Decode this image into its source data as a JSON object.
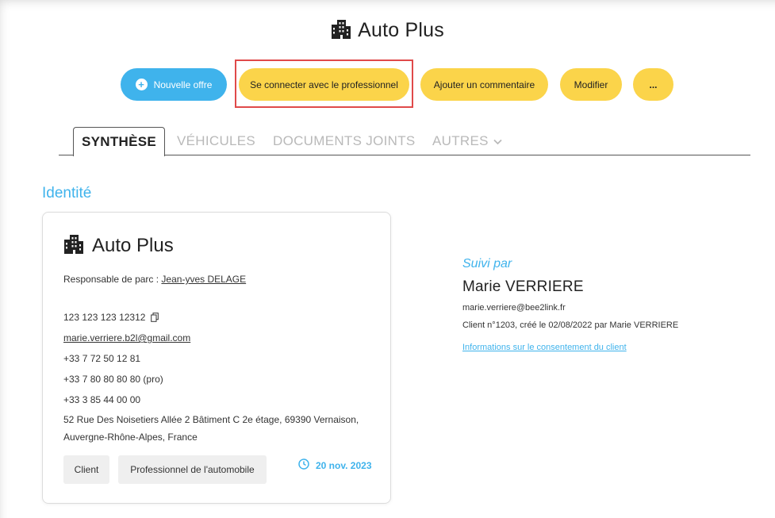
{
  "header": {
    "title": "Auto Plus",
    "icon": "building-icon"
  },
  "actions": {
    "new_offer": "Nouvelle offre",
    "connect_pro": "Se connecter avec le professionnel",
    "add_comment": "Ajouter un commentaire",
    "edit": "Modifier",
    "more": "...",
    "colors": {
      "blue": "#3fb3ec",
      "yellow": "#fbd44a",
      "highlight": "#e04a4a"
    }
  },
  "tabs": [
    {
      "label": "SYNTHÈSE",
      "active": true
    },
    {
      "label": "VÉHICULES",
      "active": false
    },
    {
      "label": "DOCUMENTS JOINTS",
      "active": false
    },
    {
      "label": "AUTRES",
      "active": false,
      "has_dropdown": true
    }
  ],
  "identity": {
    "section_title": "Identité",
    "name": "Auto Plus",
    "manager_label": "Responsable de parc :",
    "manager_name": "Jean-yves DELAGE",
    "siret": "123 123 123 12312",
    "email": "marie.verriere.b2l@gmail.com",
    "phone_1": "+33 7 72 50 12 81",
    "phone_2": "+33 7 80 80 80 80 (pro)",
    "phone_3": "+33 3 85 44 00 00",
    "address_line_1": "52 Rue Des Noisetiers Allée 2 Bâtiment C 2e étage, 69390 Vernaison,",
    "address_line_2": "Auvergne-Rhône-Alpes, France",
    "tags": [
      "Client",
      "Professionnel de l'automobile"
    ],
    "date": "20 nov. 2023"
  },
  "followup": {
    "label": "Suivi par",
    "name": "Marie VERRIERE",
    "email": "marie.verriere@bee2link.fr",
    "client_info": "Client n°1203, créé le 02/08/2022 par Marie VERRIERE",
    "consent_link": "Informations sur le consentement du client"
  }
}
